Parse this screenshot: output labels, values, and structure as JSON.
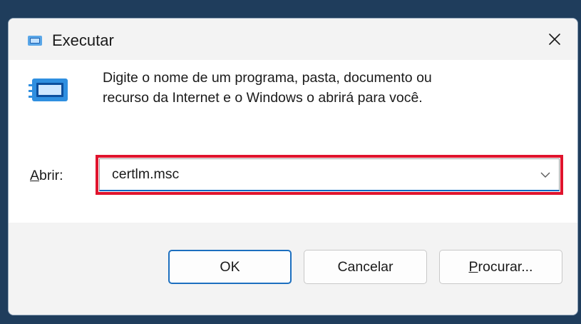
{
  "window": {
    "title": "Executar"
  },
  "content": {
    "description_line1": "Digite o nome de um programa, pasta, documento ou",
    "description_line2": "recurso da Internet e o Windows o abrirá para você.",
    "open_label_accel": "A",
    "open_label_rest": "brir:",
    "open_value": "certlm.msc"
  },
  "buttons": {
    "ok": "OK",
    "cancel": "Cancelar",
    "browse_accel": "P",
    "browse_rest": "rocurar..."
  },
  "icons": {
    "title": "run-icon",
    "main": "run-dialog-icon",
    "close": "close-icon",
    "dropdown": "chevron-down-icon"
  },
  "colors": {
    "highlight": "#e0142d",
    "accent": "#0067c0",
    "background": "#1f3d5c"
  }
}
